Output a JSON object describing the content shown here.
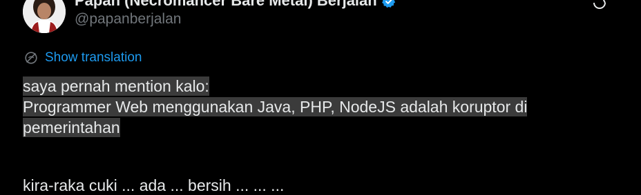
{
  "author": {
    "display_name": "Papan (Necromancer Bare Metal) Berjalan",
    "handle": "@papanberjalan",
    "verified": true
  },
  "translate": {
    "label": "Show translation",
    "icon": "globe-icon"
  },
  "tweet": {
    "line1": "saya pernah mention kalo:",
    "line2": "Programmer Web menggunakan Java, PHP, NodeJS adalah koruptor di",
    "line3": "pemerintahan",
    "line4_cut": "kira-raka cuki ... ada ... bersih ... ... ..."
  },
  "colors": {
    "background": "#000000",
    "text": "#e7e9ea",
    "muted": "#71767b",
    "accent": "#1d9bf0",
    "highlight": "#3b3b3b"
  }
}
